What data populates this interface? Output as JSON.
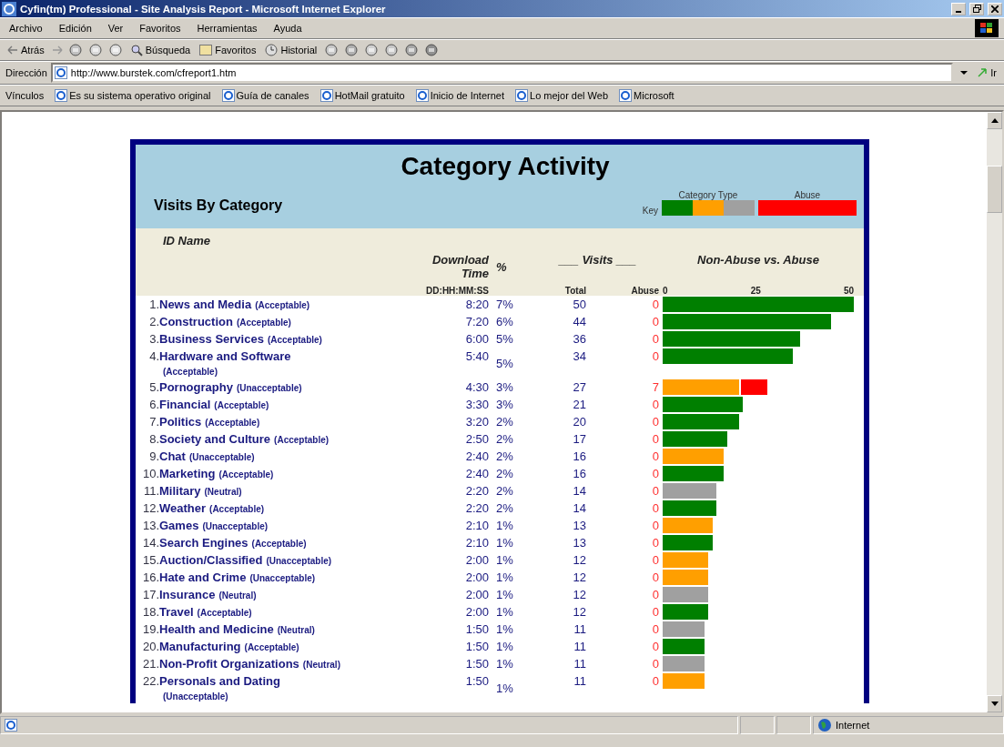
{
  "window": {
    "title": "Cyfin(tm) Professional - Site Analysis Report - Microsoft Internet Explorer"
  },
  "menu": [
    "Archivo",
    "Edición",
    "Ver",
    "Favoritos",
    "Herramientas",
    "Ayuda"
  ],
  "toolbar": {
    "back": "Atrás",
    "search": "Búsqueda",
    "favorites": "Favoritos",
    "history": "Historial"
  },
  "address": {
    "label": "Dirección",
    "value": "http://www.burstek.com/cfreport1.htm",
    "go": "Ir"
  },
  "links": {
    "label": "Vínculos",
    "items": [
      "Es su sistema operativo original",
      "Guía de canales",
      "HotMail gratuito",
      "Inicio de Internet",
      "Lo mejor del Web",
      "Microsoft"
    ]
  },
  "report": {
    "title": "Category Activity",
    "subtitle": "Visits By Category",
    "key": {
      "label": "Key",
      "category_type": "Category Type",
      "abuse": "Abuse",
      "category_swatches": [
        {
          "color": "#007f00"
        },
        {
          "color": "#ff9f00"
        },
        {
          "color": "#a0a0a0"
        }
      ],
      "abuse_swatch": {
        "color": "#ff0000"
      }
    },
    "columns": {
      "id_name": "ID Name",
      "download_time": "Download Time",
      "time_format": "DD:HH:MM:SS",
      "percent": "%",
      "visits": "___ Visits ___",
      "total": "Total",
      "abuse": "Abuse",
      "chart": "Non-Abuse vs. Abuse",
      "scale": [
        "0",
        "25",
        "50"
      ]
    },
    "rows": [
      {
        "id": "1.",
        "name": "News and Media",
        "category": "(Acceptable)",
        "color": "#007f00",
        "time": "8:20",
        "percent": "7%",
        "total": "50",
        "abuse": "0"
      },
      {
        "id": "2.",
        "name": "Construction",
        "category": "(Acceptable)",
        "color": "#007f00",
        "time": "7:20",
        "percent": "6%",
        "total": "44",
        "abuse": "0"
      },
      {
        "id": "3.",
        "name": "Business Services",
        "category": "(Acceptable)",
        "color": "#007f00",
        "time": "6:00",
        "percent": "5%",
        "total": "36",
        "abuse": "0"
      },
      {
        "id": "4.",
        "name": "Hardware and Software",
        "category": "(Acceptable)",
        "color": "#007f00",
        "time": "5:40",
        "percent": "5%",
        "total": "34",
        "abuse": "0"
      },
      {
        "id": "5.",
        "name": "Pornography",
        "category": "(Unacceptable)",
        "color": "#ff9f00",
        "time": "4:30",
        "percent": "3%",
        "total": "27",
        "abuse": "7"
      },
      {
        "id": "6.",
        "name": "Financial",
        "category": "(Acceptable)",
        "color": "#007f00",
        "time": "3:30",
        "percent": "3%",
        "total": "21",
        "abuse": "0"
      },
      {
        "id": "7.",
        "name": "Politics",
        "category": "(Acceptable)",
        "color": "#007f00",
        "time": "3:20",
        "percent": "2%",
        "total": "20",
        "abuse": "0"
      },
      {
        "id": "8.",
        "name": "Society and Culture",
        "category": "(Acceptable)",
        "color": "#007f00",
        "time": "2:50",
        "percent": "2%",
        "total": "17",
        "abuse": "0"
      },
      {
        "id": "9.",
        "name": "Chat",
        "category": "(Unacceptable)",
        "color": "#ff9f00",
        "time": "2:40",
        "percent": "2%",
        "total": "16",
        "abuse": "0"
      },
      {
        "id": "10.",
        "name": "Marketing",
        "category": "(Acceptable)",
        "color": "#007f00",
        "time": "2:40",
        "percent": "2%",
        "total": "16",
        "abuse": "0"
      },
      {
        "id": "11.",
        "name": "Military",
        "category": "(Neutral)",
        "color": "#a0a0a0",
        "time": "2:20",
        "percent": "2%",
        "total": "14",
        "abuse": "0"
      },
      {
        "id": "12.",
        "name": "Weather",
        "category": "(Acceptable)",
        "color": "#007f00",
        "time": "2:20",
        "percent": "2%",
        "total": "14",
        "abuse": "0"
      },
      {
        "id": "13.",
        "name": "Games",
        "category": "(Unacceptable)",
        "color": "#ff9f00",
        "time": "2:10",
        "percent": "1%",
        "total": "13",
        "abuse": "0"
      },
      {
        "id": "14.",
        "name": "Search Engines",
        "category": "(Acceptable)",
        "color": "#007f00",
        "time": "2:10",
        "percent": "1%",
        "total": "13",
        "abuse": "0"
      },
      {
        "id": "15.",
        "name": "Auction/Classified",
        "category": "(Unacceptable)",
        "color": "#ff9f00",
        "time": "2:00",
        "percent": "1%",
        "total": "12",
        "abuse": "0"
      },
      {
        "id": "16.",
        "name": "Hate and Crime",
        "category": "(Unacceptable)",
        "color": "#ff9f00",
        "time": "2:00",
        "percent": "1%",
        "total": "12",
        "abuse": "0"
      },
      {
        "id": "17.",
        "name": "Insurance",
        "category": "(Neutral)",
        "color": "#a0a0a0",
        "time": "2:00",
        "percent": "1%",
        "total": "12",
        "abuse": "0"
      },
      {
        "id": "18.",
        "name": "Travel",
        "category": "(Acceptable)",
        "color": "#007f00",
        "time": "2:00",
        "percent": "1%",
        "total": "12",
        "abuse": "0"
      },
      {
        "id": "19.",
        "name": "Health and Medicine",
        "category": "(Neutral)",
        "color": "#a0a0a0",
        "time": "1:50",
        "percent": "1%",
        "total": "11",
        "abuse": "0"
      },
      {
        "id": "20.",
        "name": "Manufacturing",
        "category": "(Acceptable)",
        "color": "#007f00",
        "time": "1:50",
        "percent": "1%",
        "total": "11",
        "abuse": "0"
      },
      {
        "id": "21.",
        "name": "Non-Profit Organizations",
        "category": "(Neutral)",
        "color": "#a0a0a0",
        "time": "1:50",
        "percent": "1%",
        "total": "11",
        "abuse": "0"
      },
      {
        "id": "22.",
        "name": "Personals and Dating",
        "category": "(Unacceptable)",
        "color": "#ff9f00",
        "time": "1:50",
        "percent": "1%",
        "total": "11",
        "abuse": "0"
      }
    ]
  },
  "status_bar": {
    "zone": "Internet"
  }
}
